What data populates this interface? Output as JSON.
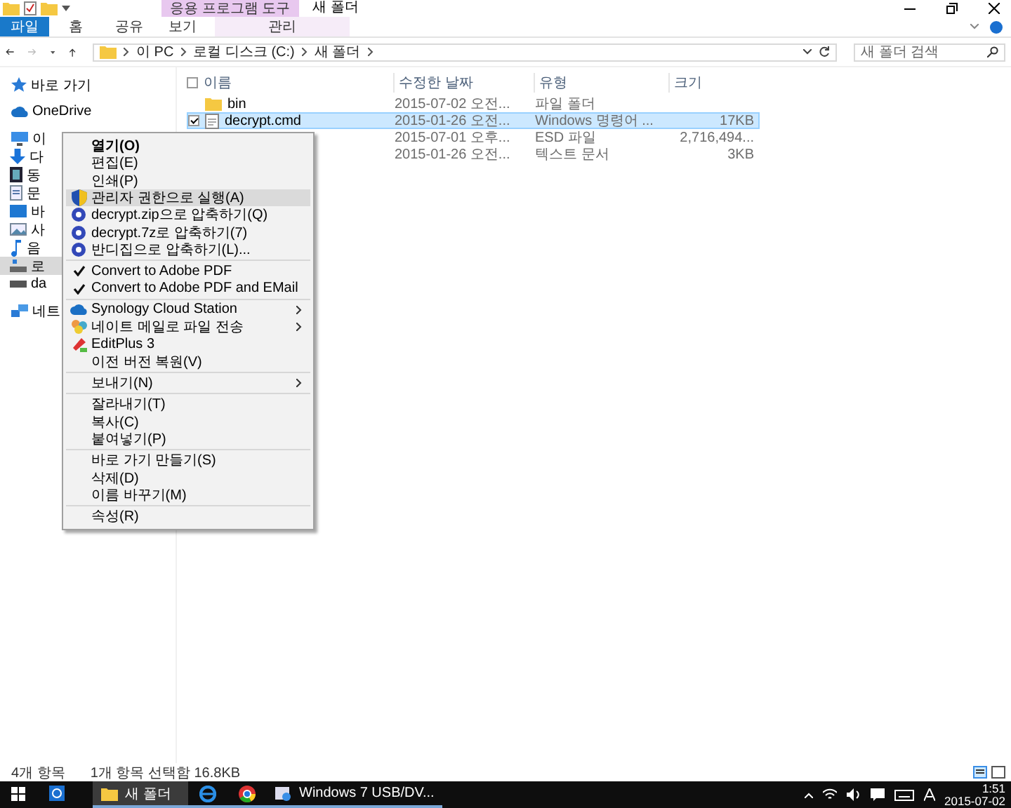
{
  "window": {
    "title": "새 폴더",
    "context_tab_group": "응용 프로그램 도구"
  },
  "ribbon_tabs": [
    {
      "label": "파일",
      "kind": "file",
      "selected": false
    },
    {
      "label": "홈",
      "kind": "normal",
      "selected": false
    },
    {
      "label": "공유",
      "kind": "normal",
      "selected": false
    },
    {
      "label": "보기",
      "kind": "normal",
      "selected": false
    },
    {
      "label": "관리",
      "kind": "context",
      "selected": false
    }
  ],
  "address_bar": {
    "path": [
      "이 PC",
      "로컬 디스크 (C:)",
      "새 폴더"
    ]
  },
  "search": {
    "placeholder": "새 폴더 검색"
  },
  "sidebar": {
    "items": [
      {
        "label": "바로 가기",
        "kind": "star",
        "selected": false
      },
      {
        "label": "OneDrive",
        "kind": "cloud",
        "selected": false
      },
      {
        "label": "이",
        "kind": "pc",
        "selected": false,
        "children": [
          {
            "label": "다",
            "kind": "download",
            "selected": false
          },
          {
            "label": "동",
            "kind": "video",
            "selected": false
          },
          {
            "label": "문",
            "kind": "doc",
            "selected": false
          },
          {
            "label": "바",
            "kind": "desktop",
            "selected": false
          },
          {
            "label": "사",
            "kind": "photo",
            "selected": false
          },
          {
            "label": "음",
            "kind": "music",
            "selected": false
          },
          {
            "label": "로",
            "kind": "disk",
            "selected": true
          },
          {
            "label": "da",
            "kind": "drive",
            "selected": false
          }
        ]
      },
      {
        "label": "네트",
        "kind": "network",
        "selected": false
      }
    ]
  },
  "file_list": {
    "columns": [
      "이름",
      "수정한 날짜",
      "유형",
      "크기"
    ],
    "all_selected": false,
    "rows": [
      {
        "name": "bin",
        "modified": "2015-07-02 오전...",
        "type": "파일 폴더",
        "kind": "folder",
        "selected": false
      },
      {
        "name": "decrypt.cmd",
        "modified": "2015-01-26 오전...",
        "type": "Windows 명령어 ...",
        "size": "17KB",
        "kind": "file",
        "selected": true
      },
      {
        "modified": "2015-07-01 오후...",
        "type": "ESD 파일",
        "size": "2,716,494...",
        "selected": false
      },
      {
        "modified": "2015-01-26 오전...",
        "type": "텍스트 문서",
        "size": "3KB",
        "selected": false
      }
    ]
  },
  "context_menu": {
    "groups": [
      [
        {
          "label": "열기(O)",
          "kind": "plain",
          "default": true,
          "selected": false,
          "submenu": false
        },
        {
          "label": "편집(E)",
          "kind": "plain",
          "default": false,
          "selected": false,
          "submenu": false
        },
        {
          "label": "인쇄(P)",
          "kind": "plain",
          "default": false,
          "selected": false,
          "submenu": false
        },
        {
          "label": "관리자 권한으로 실행(A)",
          "kind": "shield",
          "default": false,
          "selected": true,
          "submenu": false
        },
        {
          "label": "decrypt.zip으로 압축하기(Q)",
          "kind": "bandizip",
          "default": false,
          "selected": false,
          "submenu": false
        },
        {
          "label": "decrypt.7z로 압축하기(7)",
          "kind": "bandizip",
          "default": false,
          "selected": false,
          "submenu": false
        },
        {
          "label": "반디집으로 압축하기(L)...",
          "kind": "bandizip",
          "default": false,
          "selected": false,
          "submenu": false
        }
      ],
      [
        {
          "label": "Convert to Adobe PDF",
          "kind": "check",
          "default": false,
          "selected": false,
          "submenu": false
        },
        {
          "label": "Convert to Adobe PDF and EMail",
          "kind": "check",
          "default": false,
          "selected": false,
          "submenu": false
        }
      ],
      [
        {
          "label": "Synology Cloud Station",
          "kind": "cloud",
          "default": false,
          "selected": false,
          "submenu": true
        },
        {
          "label": "네이트 메일로 파일 전송",
          "kind": "nate",
          "default": false,
          "selected": false,
          "submenu": true
        },
        {
          "label": "EditPlus 3",
          "kind": "editplus",
          "default": false,
          "selected": false,
          "submenu": false
        },
        {
          "label": "이전 버전 복원(V)",
          "kind": "plain",
          "default": false,
          "selected": false,
          "submenu": false
        }
      ],
      [
        {
          "label": "보내기(N)",
          "kind": "plain",
          "default": false,
          "selected": false,
          "submenu": true
        }
      ],
      [
        {
          "label": "잘라내기(T)",
          "kind": "plain",
          "default": false,
          "selected": false,
          "submenu": false
        },
        {
          "label": "복사(C)",
          "kind": "plain",
          "default": false,
          "selected": false,
          "submenu": false
        },
        {
          "label": "붙여넣기(P)",
          "kind": "plain",
          "default": false,
          "selected": false,
          "submenu": false
        }
      ],
      [
        {
          "label": "바로 가기 만들기(S)",
          "kind": "plain",
          "default": false,
          "selected": false,
          "submenu": false
        },
        {
          "label": "삭제(D)",
          "kind": "plain",
          "default": false,
          "selected": false,
          "submenu": false
        },
        {
          "label": "이름 바꾸기(M)",
          "kind": "plain",
          "default": false,
          "selected": false,
          "submenu": false
        }
      ],
      [
        {
          "label": "속성(R)",
          "kind": "plain",
          "default": false,
          "selected": false,
          "submenu": false
        }
      ]
    ]
  },
  "status_bar": {
    "item_count": "4개 항목",
    "selection": "1개 항목 선택함 16.8KB"
  },
  "taskbar": {
    "apps": [
      {
        "label": "새 폴더",
        "kind": "explorer",
        "selected": true
      },
      {
        "kind": "ie",
        "selected": false
      },
      {
        "kind": "chrome",
        "selected": false
      },
      {
        "label": "Windows 7 USB/DV...",
        "kind": "tool",
        "selected": false
      }
    ],
    "time": "1:51",
    "date": "2015-07-02"
  }
}
